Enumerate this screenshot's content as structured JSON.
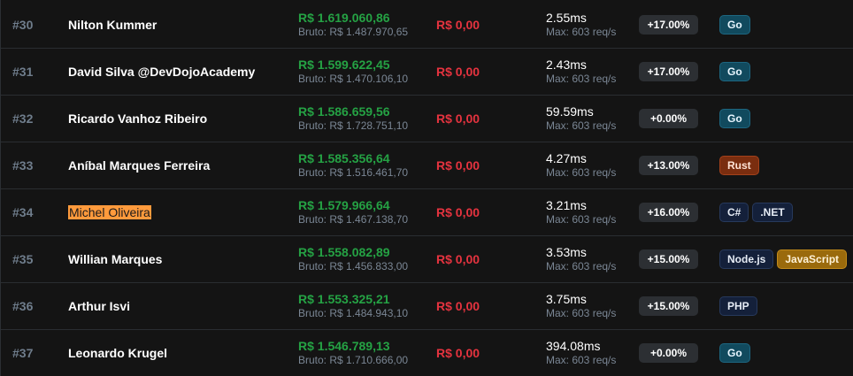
{
  "rows": [
    {
      "rank": "#30",
      "name": "Nilton Kummer",
      "net": "R$ 1.619.060,86",
      "gross": "Bruto: R$ 1.487.970,65",
      "fee": "R$ 0,00",
      "latency": "2.55ms",
      "max": "Max: 603 req/s",
      "pct": "+17.00%",
      "tags": [
        {
          "label": "Go",
          "style": "go"
        }
      ]
    },
    {
      "rank": "#31",
      "name": "David Silva @DevDojoAcademy",
      "net": "R$ 1.599.622,45",
      "gross": "Bruto: R$ 1.470.106,10",
      "fee": "R$ 0,00",
      "latency": "2.43ms",
      "max": "Max: 603 req/s",
      "pct": "+17.00%",
      "tags": [
        {
          "label": "Go",
          "style": "go"
        }
      ]
    },
    {
      "rank": "#32",
      "name": "Ricardo Vanhoz Ribeiro",
      "net": "R$ 1.586.659,56",
      "gross": "Bruto: R$ 1.728.751,10",
      "fee": "R$ 0,00",
      "latency": "59.59ms",
      "max": "Max: 603 req/s",
      "pct": "+0.00%",
      "tags": [
        {
          "label": "Go",
          "style": "go"
        }
      ]
    },
    {
      "rank": "#33",
      "name": "Aníbal Marques Ferreira",
      "net": "R$ 1.585.356,64",
      "gross": "Bruto: R$ 1.516.461,70",
      "fee": "R$ 0,00",
      "latency": "4.27ms",
      "max": "Max: 603 req/s",
      "pct": "+13.00%",
      "tags": [
        {
          "label": "Rust",
          "style": "rust"
        }
      ]
    },
    {
      "rank": "#34",
      "name": "Michel Oliveira",
      "highlight": true,
      "net": "R$ 1.579.966,64",
      "gross": "Bruto: R$ 1.467.138,70",
      "fee": "R$ 0,00",
      "latency": "3.21ms",
      "max": "Max: 603 req/s",
      "pct": "+16.00%",
      "tags": [
        {
          "label": "C#",
          "style": "dark"
        },
        {
          "label": ".NET",
          "style": "dark"
        }
      ]
    },
    {
      "rank": "#35",
      "name": "Willian Marques",
      "net": "R$ 1.558.082,89",
      "gross": "Bruto: R$ 1.456.833,00",
      "fee": "R$ 0,00",
      "latency": "3.53ms",
      "max": "Max: 603 req/s",
      "pct": "+15.00%",
      "tags": [
        {
          "label": "Node.js",
          "style": "dark"
        },
        {
          "label": "JavaScript",
          "style": "js"
        }
      ]
    },
    {
      "rank": "#36",
      "name": "Arthur Isvi",
      "net": "R$ 1.553.325,21",
      "gross": "Bruto: R$ 1.484.943,10",
      "fee": "R$ 0,00",
      "latency": "3.75ms",
      "max": "Max: 603 req/s",
      "pct": "+15.00%",
      "tags": [
        {
          "label": "PHP",
          "style": "dark"
        }
      ]
    },
    {
      "rank": "#37",
      "name": "Leonardo Krugel",
      "net": "R$ 1.546.789,13",
      "gross": "Bruto: R$ 1.710.666,00",
      "fee": "R$ 0,00",
      "latency": "394.08ms",
      "max": "Max: 603 req/s",
      "pct": "+0.00%",
      "tags": [
        {
          "label": "Go",
          "style": "go"
        }
      ]
    }
  ],
  "colors": {
    "net_green": "#25a244",
    "fee_red": "#e5333f",
    "highlight_orange": "#ff9a3c",
    "go_tag": "#114a5e",
    "rust_tag": "#7a2d0f",
    "js_tag": "#9a6a0c"
  }
}
